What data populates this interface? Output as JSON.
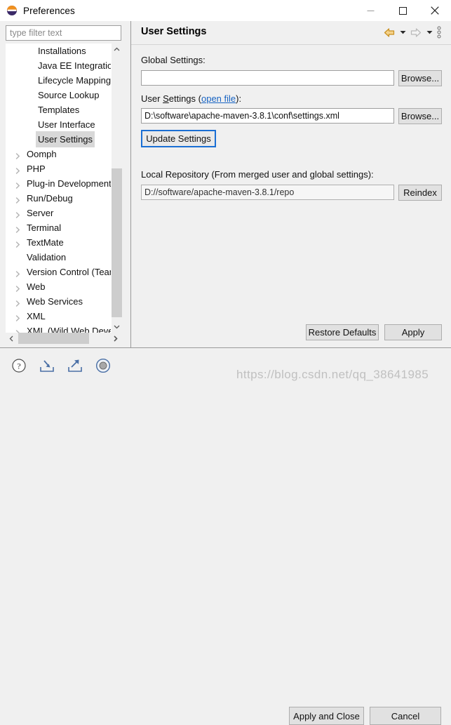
{
  "window": {
    "title": "Preferences",
    "icon": "eclipse-icon",
    "controls": {
      "minimize": "—",
      "maximize": "☐",
      "close": "✕"
    }
  },
  "sidebar": {
    "filter": {
      "placeholder": "type filter text",
      "value": ""
    },
    "tree": [
      {
        "label": "Installations",
        "expandable": false,
        "child": true,
        "selected": false
      },
      {
        "label": "Java EE Integration",
        "expandable": false,
        "child": true,
        "selected": false
      },
      {
        "label": "Lifecycle Mappings",
        "expandable": false,
        "child": true,
        "selected": false
      },
      {
        "label": "Source Lookup",
        "expandable": false,
        "child": true,
        "selected": false
      },
      {
        "label": "Templates",
        "expandable": false,
        "child": true,
        "selected": false
      },
      {
        "label": "User Interface",
        "expandable": false,
        "child": true,
        "selected": false
      },
      {
        "label": "User Settings",
        "expandable": false,
        "child": true,
        "selected": true
      },
      {
        "label": "Oomph",
        "expandable": true,
        "child": false,
        "selected": false
      },
      {
        "label": "PHP",
        "expandable": true,
        "child": false,
        "selected": false
      },
      {
        "label": "Plug-in Development",
        "expandable": true,
        "child": false,
        "selected": false
      },
      {
        "label": "Run/Debug",
        "expandable": true,
        "child": false,
        "selected": false
      },
      {
        "label": "Server",
        "expandable": true,
        "child": false,
        "selected": false
      },
      {
        "label": "Terminal",
        "expandable": true,
        "child": false,
        "selected": false
      },
      {
        "label": "TextMate",
        "expandable": true,
        "child": false,
        "selected": false
      },
      {
        "label": "Validation",
        "expandable": false,
        "child": false,
        "selected": false
      },
      {
        "label": "Version Control (Team",
        "expandable": true,
        "child": false,
        "selected": false
      },
      {
        "label": "Web",
        "expandable": true,
        "child": false,
        "selected": false
      },
      {
        "label": "Web Services",
        "expandable": true,
        "child": false,
        "selected": false
      },
      {
        "label": "XML",
        "expandable": true,
        "child": false,
        "selected": false
      },
      {
        "label": "XML (Wild Web Devel",
        "expandable": true,
        "child": false,
        "selected": false
      }
    ]
  },
  "page": {
    "title": "User Settings",
    "toolbar": {
      "back": "back-arrow-icon",
      "back_menu": "chevron-down-icon",
      "forward": "forward-arrow-icon",
      "forward_menu": "chevron-down-icon",
      "view_menu": "vertical-dots-icon"
    },
    "global_settings": {
      "label": "Global Settings:",
      "value": "",
      "browse_label": "Browse..."
    },
    "user_settings": {
      "label_before": "User ",
      "label_mnemonic": "S",
      "label_after": "ettings (",
      "link": "open file",
      "label_close": "):",
      "value": "D:\\software\\apache-maven-3.8.1\\conf\\settings.xml",
      "browse_label": "Browse...",
      "update_label": "Update Settings"
    },
    "local_repository": {
      "label": "Local Repository (From merged user and global settings):",
      "value": "D://software/apache-maven-3.8.1/repo",
      "reindex_label": "Reindex"
    },
    "restore_defaults_label": "Restore Defaults",
    "apply_label": "Apply"
  },
  "footer": {
    "icons": [
      {
        "name": "help-icon"
      },
      {
        "name": "import-icon"
      },
      {
        "name": "export-icon"
      },
      {
        "name": "record-icon"
      }
    ],
    "apply_and_close_label": "Apply and Close",
    "cancel_label": "Cancel"
  },
  "watermark": {
    "text": "https://blog.csdn.net/qq_38641985"
  },
  "colors": {
    "accent_link": "#1763c2",
    "focus_border": "#1a6fd4",
    "selection": "#d8d8d8",
    "panel_bg": "#f0f0f0",
    "tree_bg": "#ffffff",
    "back_arrow": "#e8a33d"
  }
}
